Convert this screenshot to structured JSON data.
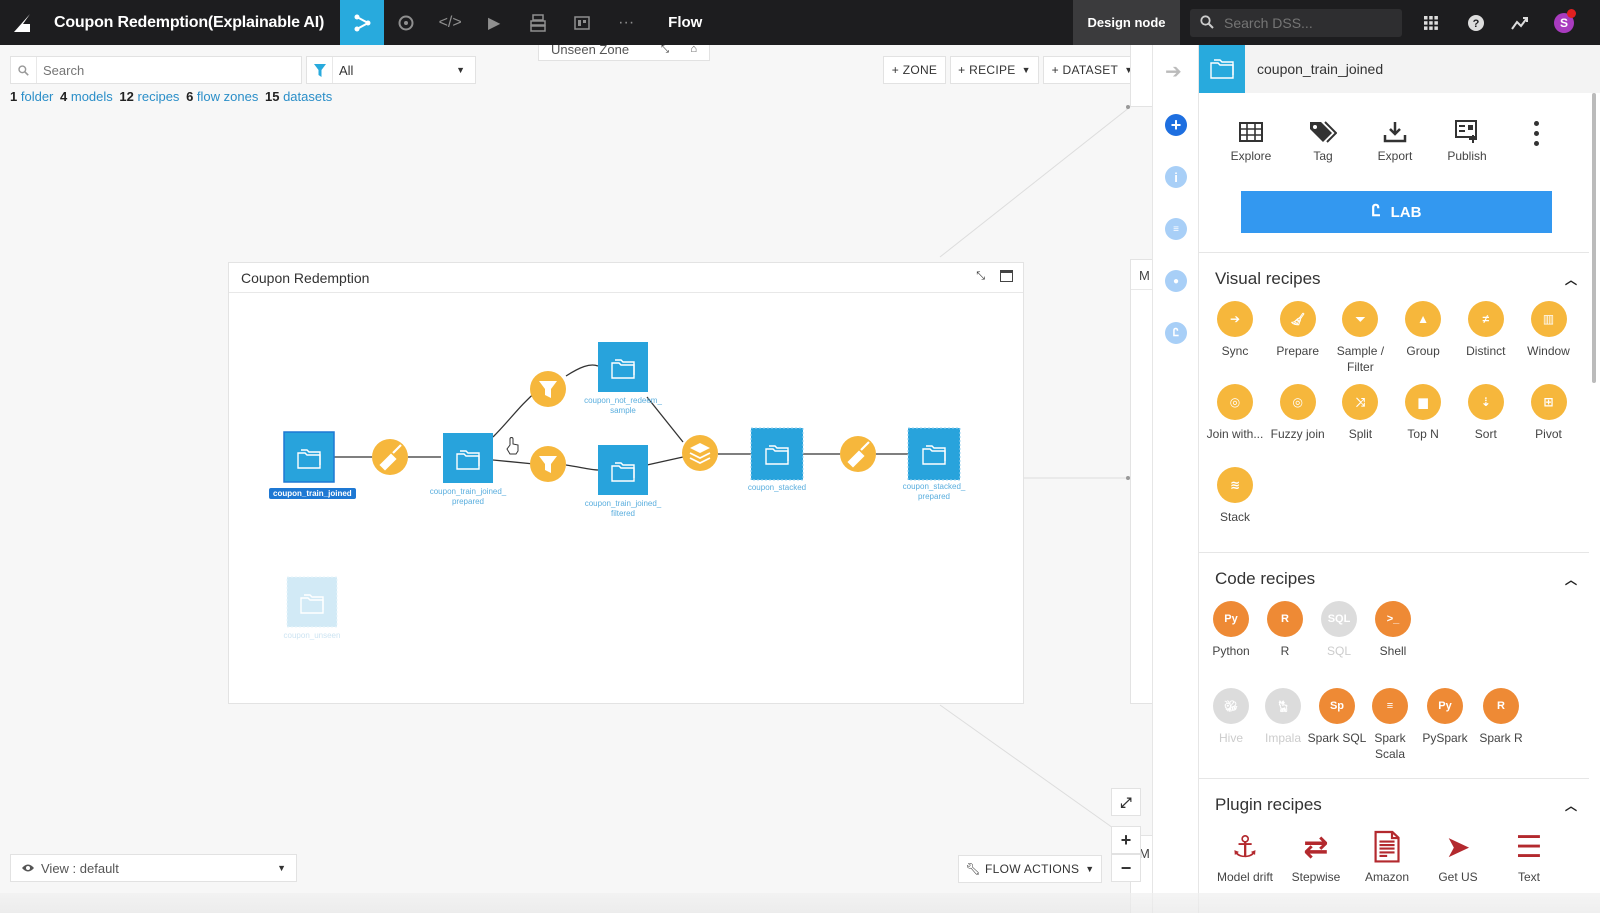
{
  "topbar": {
    "project_title": "Coupon Redemption(Explainable AI)",
    "nav_icons": [
      "flow-icon",
      "circle-icon",
      "code-icon",
      "play-icon",
      "stack-print-icon",
      "dashboard-icon",
      "more-icon"
    ],
    "section_title": "Flow",
    "node_label": "Design node",
    "search_placeholder": "Search DSS...",
    "avatar_initial": "S"
  },
  "flow": {
    "search_placeholder": "Search",
    "filter_value": "All",
    "counts": [
      {
        "num": "1",
        "label": "folder"
      },
      {
        "num": "4",
        "label": "models"
      },
      {
        "num": "12",
        "label": "recipes"
      },
      {
        "num": "6",
        "label": "flow zones"
      },
      {
        "num": "15",
        "label": "datasets"
      }
    ],
    "unseen_zone": "Unseen Zone",
    "buttons": {
      "zone": "+ ZONE",
      "recipe": "+ RECIPE",
      "dataset": "+ DATASET"
    },
    "zone_title": "Coupon Redemption",
    "side_zone_label": "M",
    "side_zone_bottom_label": "M",
    "view_select": "View : default",
    "flow_actions": "FLOW ACTIONS",
    "nodes": {
      "coupon_train_joined": "coupon_train_joined",
      "coupon_train_joined_prepared_1": "coupon_train_joined_",
      "coupon_train_joined_prepared_2": "prepared",
      "coupon_not_redeem_1": "coupon_not_redeem_",
      "coupon_not_redeem_2": "sample",
      "coupon_train_joined_filtered_1": "coupon_train_joined_",
      "coupon_train_joined_filtered_2": "filtered",
      "coupon_stacked": "coupon_stacked",
      "coupon_stacked_prepared_1": "coupon_stacked_",
      "coupon_stacked_prepared_2": "prepared",
      "coupon_unseen": "coupon_unseen"
    }
  },
  "panel": {
    "dataset_name": "coupon_train_joined",
    "actions": [
      "Explore",
      "Tag",
      "Export",
      "Publish"
    ],
    "lab_label": "LAB",
    "visual_recipes": {
      "title": "Visual recipes",
      "items": [
        {
          "label": "Sync"
        },
        {
          "label": "Prepare"
        },
        {
          "label": "Sample / Filter"
        },
        {
          "label": "Group"
        },
        {
          "label": "Distinct"
        },
        {
          "label": "Window"
        },
        {
          "label": "Join with..."
        },
        {
          "label": "Fuzzy join"
        },
        {
          "label": "Split"
        },
        {
          "label": "Top N"
        },
        {
          "label": "Sort"
        },
        {
          "label": "Pivot"
        },
        {
          "label": "Stack"
        }
      ]
    },
    "code_recipes": {
      "title": "Code recipes",
      "items": [
        {
          "label": "Python",
          "enabled": true
        },
        {
          "label": "R",
          "enabled": true
        },
        {
          "label": "SQL",
          "enabled": false
        },
        {
          "label": "Shell",
          "enabled": true
        },
        {
          "label": "Hive",
          "enabled": false
        },
        {
          "label": "Impala",
          "enabled": false
        },
        {
          "label": "Spark SQL",
          "enabled": true
        },
        {
          "label": "Spark Scala",
          "enabled": true
        },
        {
          "label": "PySpark",
          "enabled": true
        },
        {
          "label": "Spark R",
          "enabled": true
        }
      ]
    },
    "plugin_recipes": {
      "title": "Plugin recipes",
      "items": [
        {
          "label": "Model drift"
        },
        {
          "label": "Stepwise"
        },
        {
          "label": "Amazon"
        },
        {
          "label": "Get US"
        },
        {
          "label": "Text"
        }
      ]
    }
  },
  "colors": {
    "accent": "#28aadd",
    "visual_recipe": "#f6b73c",
    "code_recipe": "#ee8a35",
    "plugin_recipe": "#b3292e",
    "lab": "#3398f0"
  }
}
